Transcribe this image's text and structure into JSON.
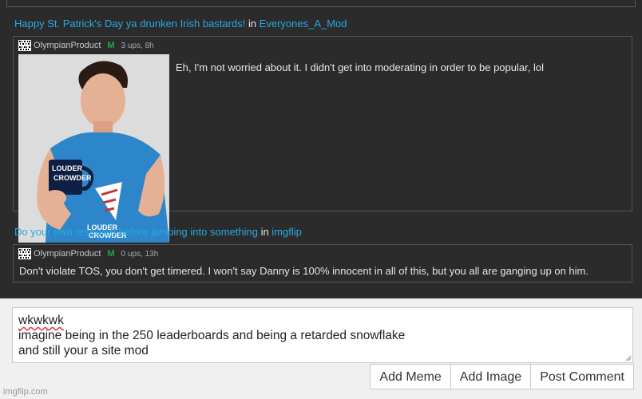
{
  "posts": [
    {
      "title_link": "Happy St. Patrick's Day ya drunken Irish bastards!",
      "in_word": " in ",
      "stream_link": "Everyones_A_Mod",
      "comment": {
        "username": "OlympianProduct",
        "mod_badge": "M",
        "stats": "3 ups, 8h",
        "text": "Eh, I'm not worried about it. I didn't get into moderating in order to be popular, lol",
        "image_mug_text": [
          "LOUDER",
          "WITH",
          "CROWDER"
        ],
        "image_shirt_text": [
          "LOUDER",
          "WITH",
          "CROWDER"
        ]
      }
    },
    {
      "title_link": "Do your own research before jumping into something",
      "in_word": " in ",
      "stream_link": "imgflip",
      "comment": {
        "username": "OlympianProduct",
        "mod_badge": "M",
        "stats": "0 ups, 13h",
        "text": "Don't violate TOS, you don't get timered. I won't say Danny is 100% innocent in all of this, but you all are ganging up on him."
      }
    }
  ],
  "reply": {
    "lines": [
      "wkwkwk",
      "imagine being in the 250 leaderboards and being a retarded snowflake",
      "and still your a site mod"
    ]
  },
  "buttons": {
    "add_meme": "Add Meme",
    "add_image": "Add Image",
    "post_comment": "Post Comment"
  },
  "watermark": "imgflip.com",
  "colors": {
    "link": "#29a9e0",
    "mod_badge": "#1ea64a",
    "dark_bg": "#2b2b2b",
    "light_bg": "#f0f0f0"
  }
}
